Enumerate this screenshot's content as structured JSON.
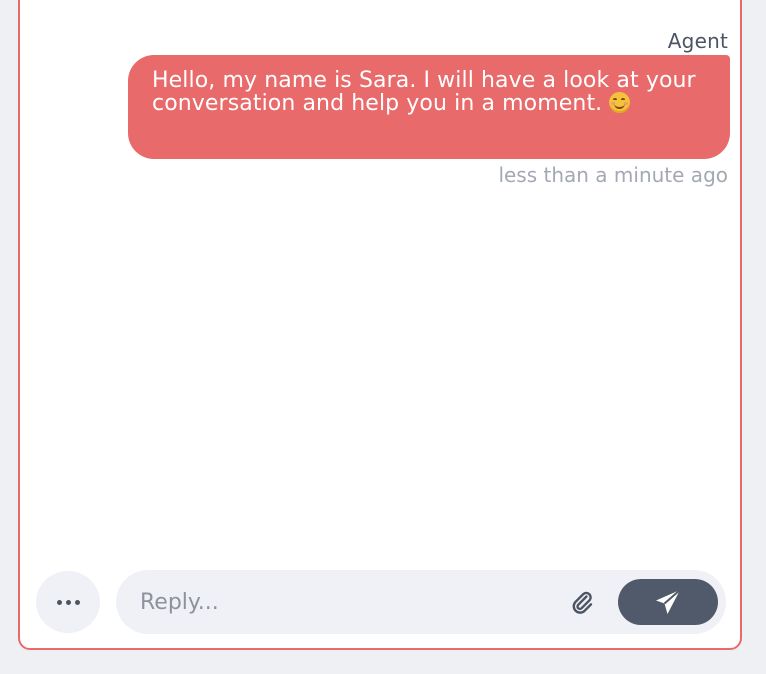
{
  "message": {
    "sender": "Agent",
    "text": "Hello, my name is Sara. I will have a look at your conversation and help you in a moment. ",
    "emoji": "smiling-face-emoji",
    "timestamp": "less than a minute ago"
  },
  "composer": {
    "placeholder": "Reply...",
    "value": "",
    "more_icon": "ellipsis-icon",
    "attach_icon": "paperclip-icon",
    "send_icon": "paper-plane-icon"
  },
  "colors": {
    "accent": "#e86a6a",
    "send_button": "#515a6a",
    "input_background": "#f0f1f6"
  }
}
